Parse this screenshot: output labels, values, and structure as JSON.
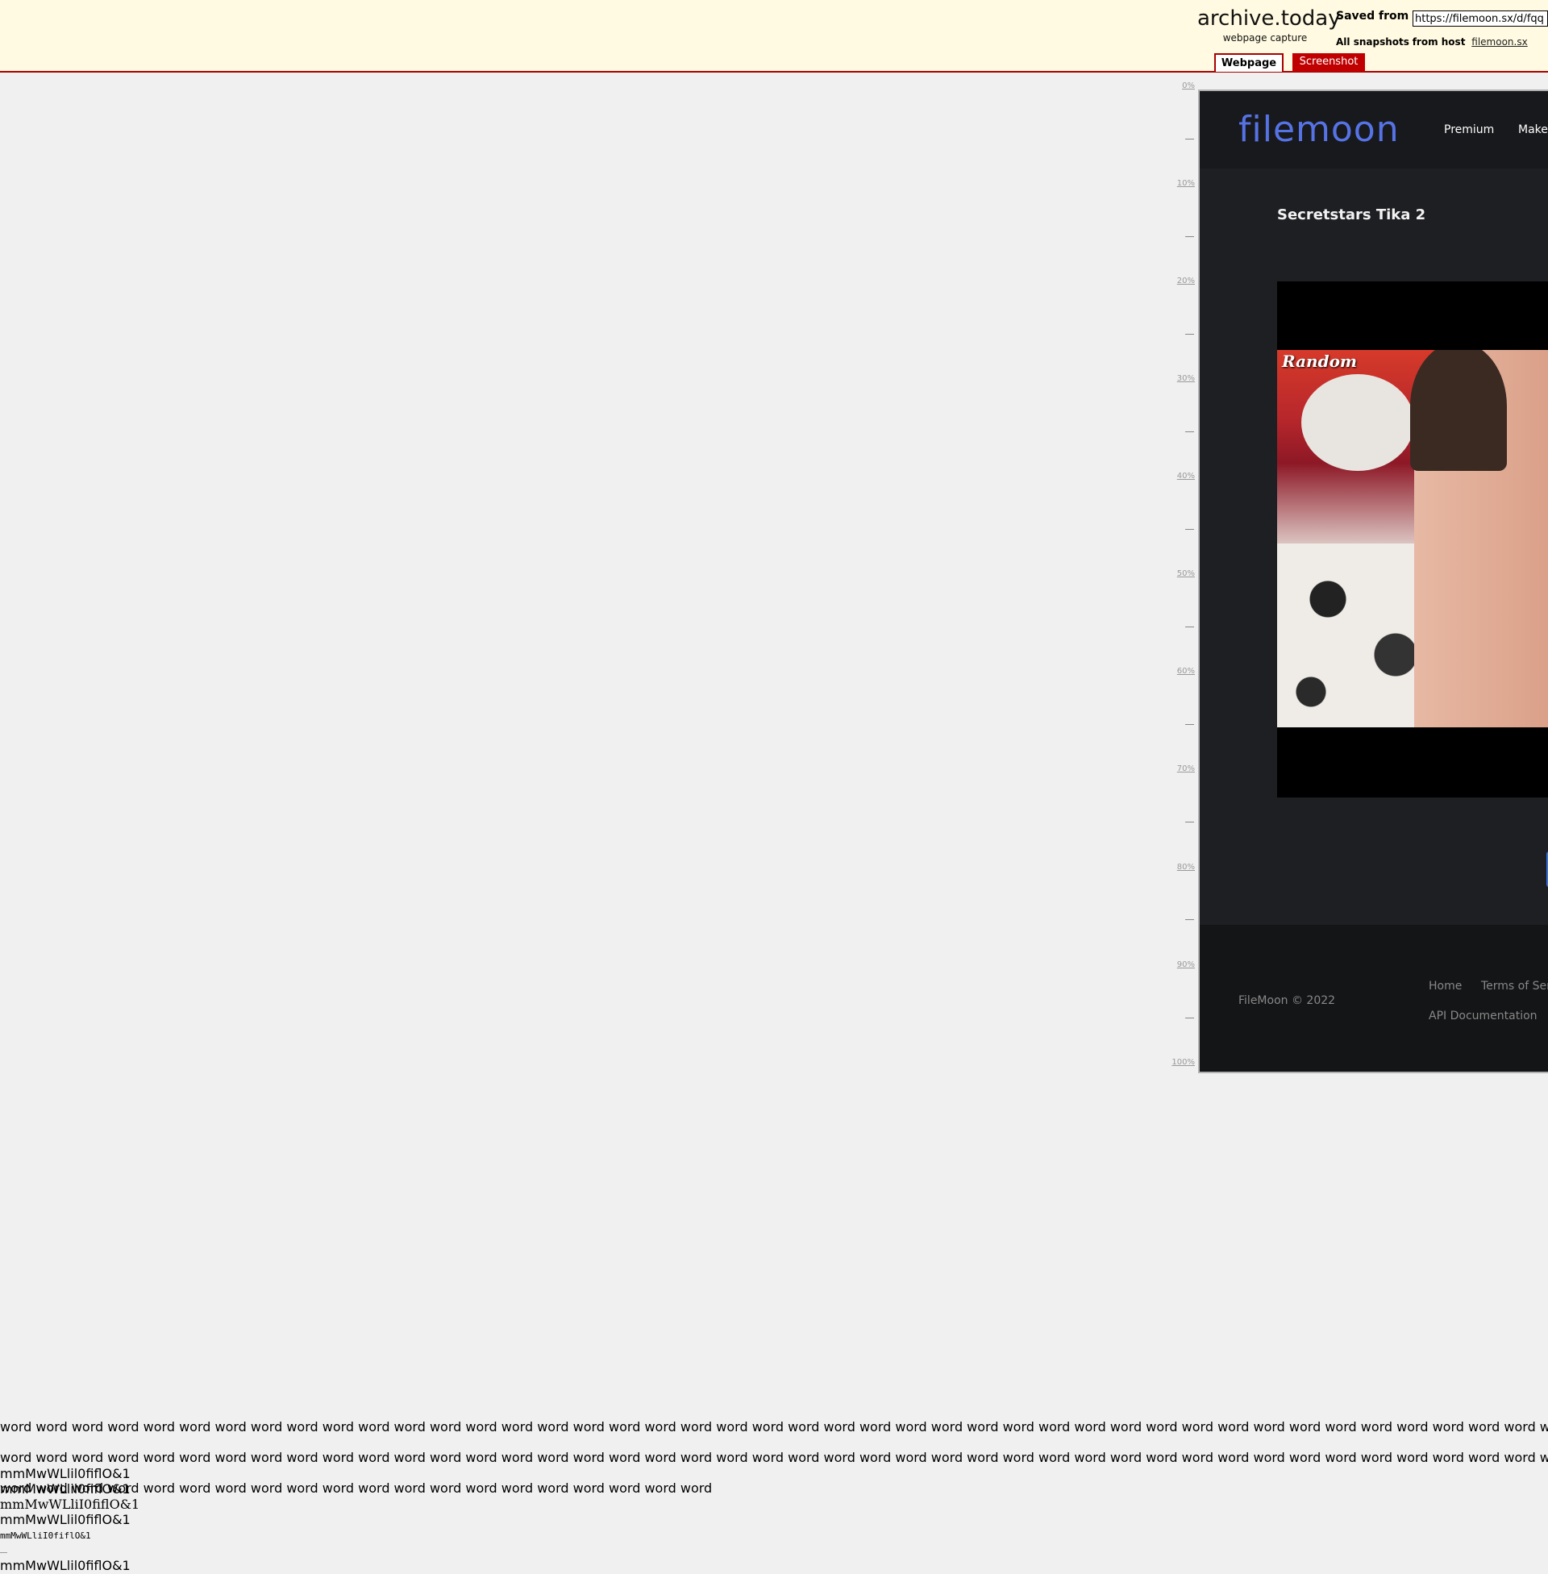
{
  "header": {
    "logo_title": "archive.today",
    "logo_subtitle": "webpage capture",
    "saved_from_label": "Saved from",
    "url_value": "https://filemoon.sx/d/fqq",
    "all_snapshots_label": "All snapshots",
    "from_host_label": "from host",
    "host_link": "filemoon.sx",
    "tabs": [
      {
        "label": "Webpage",
        "active": true
      },
      {
        "label": "Screenshot",
        "active": false
      }
    ]
  },
  "ruler": {
    "labels": [
      "0%",
      "10%",
      "20%",
      "30%",
      "40%",
      "50%",
      "60%",
      "70%",
      "80%",
      "90%",
      "100%"
    ]
  },
  "capture": {
    "logo": "filemoon",
    "nav": {
      "premium": "Premium",
      "make": "Make"
    },
    "video_title": "Secretstars Tika 2",
    "video_overlay": "Random",
    "footer": {
      "copyright": "FileMoon © 2022",
      "home": "Home",
      "terms": "Terms of Serv",
      "api": "API Documentation"
    },
    "colors": {
      "brand": "#5673e6",
      "background": "#1e1f22"
    }
  },
  "probe": {
    "word_lines": [
      "word word word word word word word word word word word word word word word word word word word word word word word word word word word word word word word word word word word word word word word word word word word word w",
      "word word word word word word word word word word word word word word word word word word word word word word word word word word word word word word word word word word word word word word word word word word word word w",
      "word word word word word word word word word word word word word word word word word word word word"
    ],
    "glyphs": "mmMwWLlil0fiflO&1",
    "glyphs_serif": "mmMwWLliI0fiflO&1",
    "glyphs_mono": "mmMwWLliI0fiflO&1"
  }
}
